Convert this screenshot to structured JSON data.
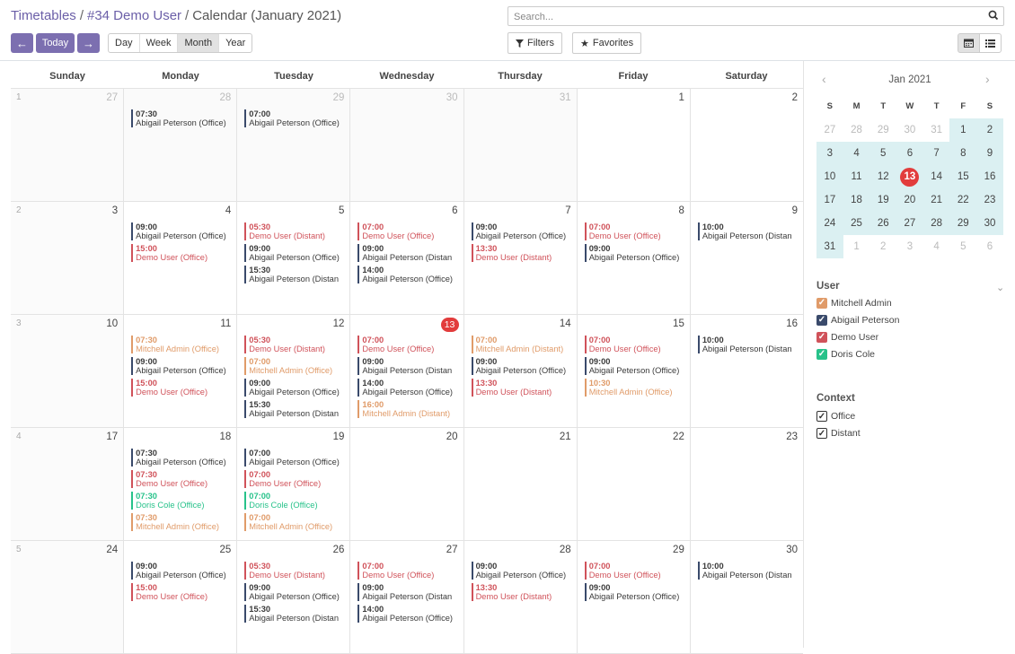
{
  "breadcrumb": {
    "part1": "Timetables",
    "sep1": "/",
    "part2": "#34 Demo User",
    "sep2": "/",
    "current": "Calendar (January 2021)"
  },
  "nav": {
    "prev_icon": "arrow-left-icon",
    "today_label": "Today",
    "next_icon": "arrow-right-icon"
  },
  "scales": [
    {
      "label": "Day"
    },
    {
      "label": "Week"
    },
    {
      "label": "Month",
      "active": true
    },
    {
      "label": "Year"
    }
  ],
  "search": {
    "placeholder": "Search..."
  },
  "filters_label": "Filters",
  "favorites_label": "Favorites",
  "weekdays": [
    "Sunday",
    "Monday",
    "Tuesday",
    "Wednesday",
    "Thursday",
    "Friday",
    "Saturday"
  ],
  "colors": {
    "Mitchell Admin": "#e09b69",
    "Abigail Peterson": "#3a4a6b",
    "Demo User": "#d0525a",
    "Doris Cole": "#27c28a"
  },
  "weeks": [
    {
      "wk": "1",
      "days": [
        {
          "day": "27",
          "other": true,
          "events": []
        },
        {
          "day": "28",
          "other": true,
          "events": [
            {
              "time": "07:30",
              "label": "Abigail Peterson (Office)",
              "user": "Abigail Peterson"
            }
          ]
        },
        {
          "day": "29",
          "other": true,
          "events": [
            {
              "time": "07:00",
              "label": "Abigail Peterson (Office)",
              "user": "Abigail Peterson"
            }
          ]
        },
        {
          "day": "30",
          "other": true,
          "events": []
        },
        {
          "day": "31",
          "other": true,
          "events": []
        },
        {
          "day": "1",
          "events": []
        },
        {
          "day": "2",
          "events": []
        }
      ]
    },
    {
      "wk": "2",
      "days": [
        {
          "day": "3",
          "events": []
        },
        {
          "day": "4",
          "events": [
            {
              "time": "09:00",
              "label": "Abigail Peterson (Office)",
              "user": "Abigail Peterson"
            },
            {
              "time": "15:00",
              "label": "Demo User (Office)",
              "user": "Demo User"
            }
          ]
        },
        {
          "day": "5",
          "events": [
            {
              "time": "05:30",
              "label": "Demo User (Distant)",
              "user": "Demo User"
            },
            {
              "time": "09:00",
              "label": "Abigail Peterson (Office)",
              "user": "Abigail Peterson"
            },
            {
              "time": "15:30",
              "label": "Abigail Peterson (Distan",
              "user": "Abigail Peterson"
            }
          ]
        },
        {
          "day": "6",
          "events": [
            {
              "time": "07:00",
              "label": "Demo User (Office)",
              "user": "Demo User"
            },
            {
              "time": "09:00",
              "label": "Abigail Peterson (Distan",
              "user": "Abigail Peterson"
            },
            {
              "time": "14:00",
              "label": "Abigail Peterson (Office)",
              "user": "Abigail Peterson"
            }
          ]
        },
        {
          "day": "7",
          "events": [
            {
              "time": "09:00",
              "label": "Abigail Peterson (Office)",
              "user": "Abigail Peterson"
            },
            {
              "time": "13:30",
              "label": "Demo User (Distant)",
              "user": "Demo User"
            }
          ]
        },
        {
          "day": "8",
          "events": [
            {
              "time": "07:00",
              "label": "Demo User (Office)",
              "user": "Demo User"
            },
            {
              "time": "09:00",
              "label": "Abigail Peterson (Office)",
              "user": "Abigail Peterson"
            }
          ]
        },
        {
          "day": "9",
          "events": [
            {
              "time": "10:00",
              "label": "Abigail Peterson (Distan",
              "user": "Abigail Peterson"
            }
          ]
        }
      ]
    },
    {
      "wk": "3",
      "days": [
        {
          "day": "10",
          "events": []
        },
        {
          "day": "11",
          "events": [
            {
              "time": "07:30",
              "label": "Mitchell Admin (Office)",
              "user": "Mitchell Admin"
            },
            {
              "time": "09:00",
              "label": "Abigail Peterson (Office)",
              "user": "Abigail Peterson"
            },
            {
              "time": "15:00",
              "label": "Demo User (Office)",
              "user": "Demo User"
            }
          ]
        },
        {
          "day": "12",
          "events": [
            {
              "time": "05:30",
              "label": "Demo User (Distant)",
              "user": "Demo User"
            },
            {
              "time": "07:00",
              "label": "Mitchell Admin (Office)",
              "user": "Mitchell Admin"
            },
            {
              "time": "09:00",
              "label": "Abigail Peterson (Office)",
              "user": "Abigail Peterson"
            },
            {
              "time": "15:30",
              "label": "Abigail Peterson (Distan",
              "user": "Abigail Peterson"
            }
          ]
        },
        {
          "day": "13",
          "today": true,
          "events": [
            {
              "time": "07:00",
              "label": "Demo User (Office)",
              "user": "Demo User"
            },
            {
              "time": "09:00",
              "label": "Abigail Peterson (Distan",
              "user": "Abigail Peterson"
            },
            {
              "time": "14:00",
              "label": "Abigail Peterson (Office)",
              "user": "Abigail Peterson"
            },
            {
              "time": "16:00",
              "label": "Mitchell Admin (Distant)",
              "user": "Mitchell Admin"
            }
          ]
        },
        {
          "day": "14",
          "events": [
            {
              "time": "07:00",
              "label": "Mitchell Admin (Distant)",
              "user": "Mitchell Admin"
            },
            {
              "time": "09:00",
              "label": "Abigail Peterson (Office)",
              "user": "Abigail Peterson"
            },
            {
              "time": "13:30",
              "label": "Demo User (Distant)",
              "user": "Demo User"
            }
          ]
        },
        {
          "day": "15",
          "events": [
            {
              "time": "07:00",
              "label": "Demo User (Office)",
              "user": "Demo User"
            },
            {
              "time": "09:00",
              "label": "Abigail Peterson (Office)",
              "user": "Abigail Peterson"
            },
            {
              "time": "10:30",
              "label": "Mitchell Admin (Office)",
              "user": "Mitchell Admin"
            }
          ]
        },
        {
          "day": "16",
          "events": [
            {
              "time": "10:00",
              "label": "Abigail Peterson (Distan",
              "user": "Abigail Peterson"
            }
          ]
        }
      ]
    },
    {
      "wk": "4",
      "days": [
        {
          "day": "17",
          "events": []
        },
        {
          "day": "18",
          "events": [
            {
              "time": "07:30",
              "label": "Abigail Peterson (Office)",
              "user": "Abigail Peterson"
            },
            {
              "time": "07:30",
              "label": "Demo User (Office)",
              "user": "Demo User"
            },
            {
              "time": "07:30",
              "label": "Doris Cole (Office)",
              "user": "Doris Cole"
            },
            {
              "time": "07:30",
              "label": "Mitchell Admin (Office)",
              "user": "Mitchell Admin"
            }
          ]
        },
        {
          "day": "19",
          "events": [
            {
              "time": "07:00",
              "label": "Abigail Peterson (Office)",
              "user": "Abigail Peterson"
            },
            {
              "time": "07:00",
              "label": "Demo User (Office)",
              "user": "Demo User"
            },
            {
              "time": "07:00",
              "label": "Doris Cole (Office)",
              "user": "Doris Cole"
            },
            {
              "time": "07:00",
              "label": "Mitchell Admin (Office)",
              "user": "Mitchell Admin"
            }
          ]
        },
        {
          "day": "20",
          "events": []
        },
        {
          "day": "21",
          "events": []
        },
        {
          "day": "22",
          "events": []
        },
        {
          "day": "23",
          "events": []
        }
      ]
    },
    {
      "wk": "5",
      "days": [
        {
          "day": "24",
          "events": []
        },
        {
          "day": "25",
          "events": [
            {
              "time": "09:00",
              "label": "Abigail Peterson (Office)",
              "user": "Abigail Peterson"
            },
            {
              "time": "15:00",
              "label": "Demo User (Office)",
              "user": "Demo User"
            }
          ]
        },
        {
          "day": "26",
          "events": [
            {
              "time": "05:30",
              "label": "Demo User (Distant)",
              "user": "Demo User"
            },
            {
              "time": "09:00",
              "label": "Abigail Peterson (Office)",
              "user": "Abigail Peterson"
            },
            {
              "time": "15:30",
              "label": "Abigail Peterson (Distan",
              "user": "Abigail Peterson"
            }
          ]
        },
        {
          "day": "27",
          "events": [
            {
              "time": "07:00",
              "label": "Demo User (Office)",
              "user": "Demo User"
            },
            {
              "time": "09:00",
              "label": "Abigail Peterson (Distan",
              "user": "Abigail Peterson"
            },
            {
              "time": "14:00",
              "label": "Abigail Peterson (Office)",
              "user": "Abigail Peterson"
            }
          ]
        },
        {
          "day": "28",
          "events": [
            {
              "time": "09:00",
              "label": "Abigail Peterson (Office)",
              "user": "Abigail Peterson"
            },
            {
              "time": "13:30",
              "label": "Demo User (Distant)",
              "user": "Demo User"
            }
          ]
        },
        {
          "day": "29",
          "events": [
            {
              "time": "07:00",
              "label": "Demo User (Office)",
              "user": "Demo User"
            },
            {
              "time": "09:00",
              "label": "Abigail Peterson (Office)",
              "user": "Abigail Peterson"
            }
          ]
        },
        {
          "day": "30",
          "events": [
            {
              "time": "10:00",
              "label": "Abigail Peterson (Distan",
              "user": "Abigail Peterson"
            }
          ]
        }
      ]
    }
  ],
  "mini": {
    "title": "Jan 2021",
    "prev_icon": "chevron-left-icon",
    "next_icon": "chevron-right-icon",
    "headers": [
      "S",
      "M",
      "T",
      "W",
      "T",
      "F",
      "S"
    ],
    "rows": [
      [
        {
          "d": "27",
          "o": true
        },
        {
          "d": "28",
          "o": true
        },
        {
          "d": "29",
          "o": true
        },
        {
          "d": "30",
          "o": true
        },
        {
          "d": "31",
          "o": true
        },
        {
          "d": "1"
        },
        {
          "d": "2"
        }
      ],
      [
        {
          "d": "3"
        },
        {
          "d": "4"
        },
        {
          "d": "5"
        },
        {
          "d": "6"
        },
        {
          "d": "7"
        },
        {
          "d": "8"
        },
        {
          "d": "9"
        }
      ],
      [
        {
          "d": "10"
        },
        {
          "d": "11"
        },
        {
          "d": "12"
        },
        {
          "d": "13",
          "today": true
        },
        {
          "d": "14"
        },
        {
          "d": "15"
        },
        {
          "d": "16"
        }
      ],
      [
        {
          "d": "17"
        },
        {
          "d": "18"
        },
        {
          "d": "19"
        },
        {
          "d": "20"
        },
        {
          "d": "21"
        },
        {
          "d": "22"
        },
        {
          "d": "23"
        }
      ],
      [
        {
          "d": "24"
        },
        {
          "d": "25"
        },
        {
          "d": "26"
        },
        {
          "d": "27"
        },
        {
          "d": "28"
        },
        {
          "d": "29"
        },
        {
          "d": "30"
        }
      ],
      [
        {
          "d": "31"
        },
        {
          "d": "1",
          "o": true
        },
        {
          "d": "2",
          "o": true
        },
        {
          "d": "3",
          "o": true
        },
        {
          "d": "4",
          "o": true
        },
        {
          "d": "5",
          "o": true
        },
        {
          "d": "6",
          "o": true
        }
      ]
    ]
  },
  "user_filter": {
    "title": "User",
    "collapse_icon": "chevron-down-icon",
    "items": [
      {
        "label": "Mitchell Admin",
        "color": "#e09b69"
      },
      {
        "label": "Abigail Peterson",
        "color": "#3a4a6b"
      },
      {
        "label": "Demo User",
        "color": "#d0525a"
      },
      {
        "label": "Doris Cole",
        "color": "#27c28a"
      }
    ]
  },
  "context_filter": {
    "title": "Context",
    "items": [
      {
        "label": "Office"
      },
      {
        "label": "Distant"
      }
    ]
  }
}
